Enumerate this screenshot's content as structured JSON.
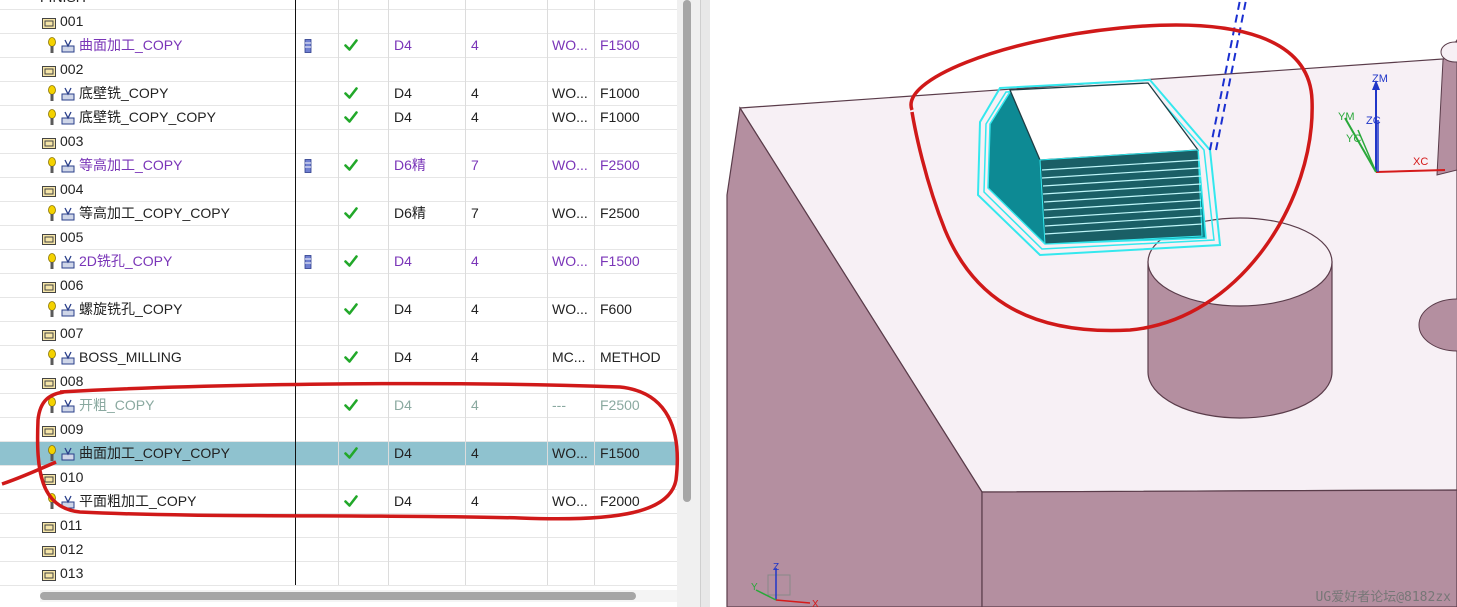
{
  "navigator": {
    "partial_header": "FINISH",
    "rows": [
      {
        "kind": "group",
        "name": "001"
      },
      {
        "kind": "op",
        "name": "曲面加工_COPY",
        "tool": "D4",
        "num": "4",
        "geom": "WO...",
        "method": "F1500",
        "style": "purple",
        "tool_icon": true,
        "icon": "contour-op-icon"
      },
      {
        "kind": "group",
        "name": "002"
      },
      {
        "kind": "op",
        "name": "底壁铣_COPY",
        "tool": "D4",
        "num": "4",
        "geom": "WO...",
        "method": "F1000",
        "style": "normal",
        "tool_icon": false,
        "icon": "floor-wall-op-icon"
      },
      {
        "kind": "op",
        "name": "底壁铣_COPY_COPY",
        "tool": "D4",
        "num": "4",
        "geom": "WO...",
        "method": "F1000",
        "style": "normal",
        "tool_icon": false,
        "icon": "floor-wall-op-icon"
      },
      {
        "kind": "group",
        "name": "003"
      },
      {
        "kind": "op",
        "name": "等高加工_COPY",
        "tool": "D6精",
        "num": "7",
        "geom": "WO...",
        "method": "F2500",
        "style": "purple",
        "tool_icon": true,
        "icon": "zlevel-op-icon"
      },
      {
        "kind": "group",
        "name": "004"
      },
      {
        "kind": "op",
        "name": "等高加工_COPY_COPY",
        "tool": "D6精",
        "num": "7",
        "geom": "WO...",
        "method": "F2500",
        "style": "normal",
        "tool_icon": false,
        "icon": "zlevel-op-icon"
      },
      {
        "kind": "group",
        "name": "005"
      },
      {
        "kind": "op",
        "name": "2D铣孔_COPY",
        "tool": "D4",
        "num": "4",
        "geom": "WO...",
        "method": "F1500",
        "style": "purple",
        "tool_icon": true,
        "icon": "hole-milling-op-icon"
      },
      {
        "kind": "group",
        "name": "006"
      },
      {
        "kind": "op",
        "name": "螺旋铣孔_COPY",
        "tool": "D4",
        "num": "4",
        "geom": "WO...",
        "method": "F600",
        "style": "normal",
        "tool_icon": false,
        "icon": "helical-op-icon"
      },
      {
        "kind": "group",
        "name": "007"
      },
      {
        "kind": "op",
        "name": "BOSS_MILLING",
        "tool": "D4",
        "num": "4",
        "geom": "MC...",
        "method": "METHOD",
        "style": "normal",
        "tool_icon": false,
        "icon": "boss-milling-op-icon"
      },
      {
        "kind": "group",
        "name": "008"
      },
      {
        "kind": "op",
        "name": "开粗_COPY",
        "tool": "D4",
        "num": "4",
        "geom": "---",
        "method": "F2500",
        "style": "gray",
        "tool_icon": false,
        "icon": "cavity-mill-op-icon"
      },
      {
        "kind": "group",
        "name": "009"
      },
      {
        "kind": "op",
        "name": "曲面加工_COPY_COPY",
        "tool": "D4",
        "num": "4",
        "geom": "WO...",
        "method": "F1500",
        "style": "selected",
        "tool_icon": false,
        "icon": "contour-op-icon"
      },
      {
        "kind": "group",
        "name": "010"
      },
      {
        "kind": "op",
        "name": "平面粗加工_COPY",
        "tool": "D4",
        "num": "4",
        "geom": "WO...",
        "method": "F2000",
        "style": "normal",
        "tool_icon": false,
        "icon": "face-rough-op-icon"
      },
      {
        "kind": "group",
        "name": "011"
      },
      {
        "kind": "group",
        "name": "012"
      },
      {
        "kind": "group",
        "name": "013"
      }
    ]
  },
  "viewport": {
    "axis_labels": {
      "zm": "ZM",
      "ym": "YM",
      "zc": "ZC",
      "yc": "YC",
      "xc": "XC"
    },
    "mini_triad": {
      "z": "Z",
      "y": "Y",
      "x": "X"
    },
    "watermark": "UG爱好者论坛@8182zx"
  },
  "colors": {
    "selection": "#8fc2cf",
    "check": "#22a82a",
    "purple_text": "#7a35b8",
    "part_top": "#f7f0f5",
    "part_side": "#b48fa0",
    "toolpath": "#34e8ee",
    "annotation": "#d01919"
  }
}
